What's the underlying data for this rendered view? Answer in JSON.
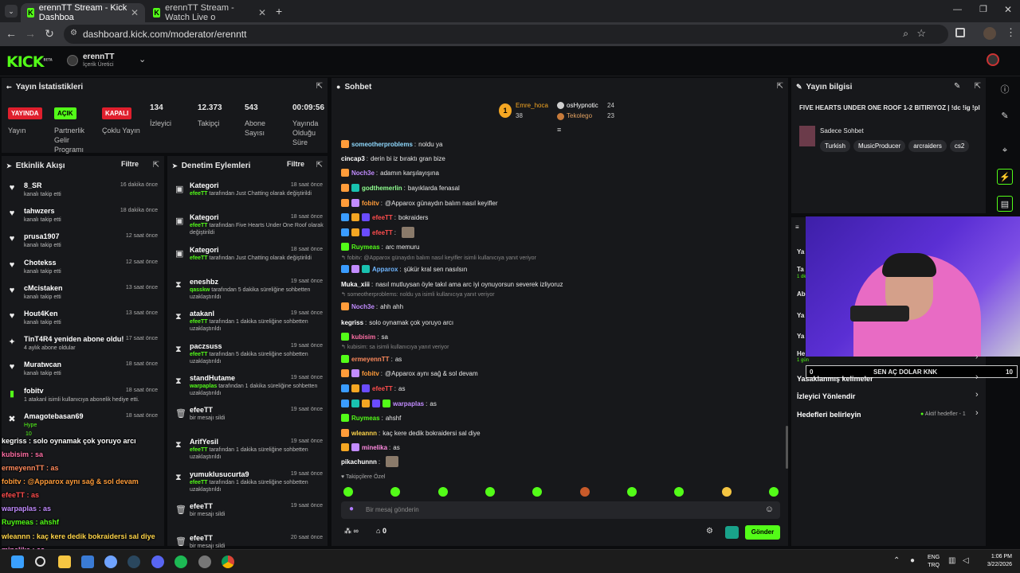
{
  "browser": {
    "tabs": [
      {
        "title": "erennTT Stream - Kick Dashboa"
      },
      {
        "title": "erennTT Stream - Watch Live o"
      }
    ],
    "url": "dashboard.kick.com/moderator/erenntt"
  },
  "header": {
    "logo": "KICK",
    "logo_tag": "BETA",
    "channel_name": "erennTT",
    "channel_role": "İçerik Üretici"
  },
  "stats": {
    "title": "Yayın İstatistikleri",
    "items": [
      {
        "badge": "YAYINDA",
        "label": "Yayın"
      },
      {
        "badge": "AÇIK",
        "label": "Partnerlik Gelir Programı"
      },
      {
        "badge": "KAPALI",
        "label": "Çoklu Yayın"
      }
    ],
    "numbers": [
      {
        "value": "134",
        "label": "İzleyici"
      },
      {
        "value": "12.373",
        "label": "Takipçi"
      },
      {
        "value": "543",
        "label": "Abone Sayısı"
      },
      {
        "value": "00:09:56",
        "label": "Yayında Olduğu Süre"
      }
    ]
  },
  "activity": {
    "title": "Etkinlik Akışı",
    "filter": "Filtre",
    "items": [
      {
        "name": "8_SR",
        "sub": "kanalı takip etti",
        "time": "16 dakika önce"
      },
      {
        "name": "tahwzers",
        "sub": "kanalı takip etti",
        "time": "18 dakika önce"
      },
      {
        "name": "prusa1907",
        "sub": "kanalı takip etti",
        "time": "12 saat önce"
      },
      {
        "name": "Chotekss",
        "sub": "kanalı takip etti",
        "time": "12 saat önce"
      },
      {
        "name": "cMcistaken",
        "sub": "kanalı takip etti",
        "time": "13 saat önce"
      },
      {
        "name": "Hout4Ken",
        "sub": "kanalı takip etti",
        "time": "13 saat önce"
      },
      {
        "name": "TinT4R4 yeniden abone oldu!",
        "sub": "4 aylık abone oldular",
        "time": "17 saat önce"
      },
      {
        "name": "Muratwcan",
        "sub": "kanalı takip etti",
        "time": "18 saat önce"
      },
      {
        "name": "fobitv",
        "sub": "1 atakanl isimli kullanıcıya abonelik hediye etti.",
        "time": "18 saat önce"
      },
      {
        "name": "Amagotebasan69",
        "sub": "Hype",
        "time": "18 saat önce"
      }
    ],
    "extra_count": "10"
  },
  "moderation": {
    "title": "Denetim Eylemleri",
    "filter": "Filtre",
    "items": [
      {
        "name": "Kategori",
        "sub_user": "efeeTT",
        "sub": "tarafından Just Chatting olarak değiştirildi",
        "time": "18 saat önce"
      },
      {
        "name": "Kategori",
        "sub_user": "efeeTT",
        "sub": "tarafından Five Hearts Under One Roof olarak değiştirildi",
        "time": "18 saat önce"
      },
      {
        "name": "Kategori",
        "sub_user": "efeeTT",
        "sub": "tarafından Just Chatting olarak değiştirildi",
        "time": "18 saat önce"
      },
      {
        "name": "eneshbz",
        "sub_user": "qasskw",
        "sub": "tarafından 5 dakika süreliğine sohbetten uzaklaştırıldı",
        "time": "19 saat önce"
      },
      {
        "name": "atakanl",
        "sub_user": "efeeTT",
        "sub": "tarafından 1 dakika süreliğine sohbetten uzaklaştırıldı",
        "time": "19 saat önce"
      },
      {
        "name": "paczsuss",
        "sub_user": "efeeTT",
        "sub": "tarafından 5 dakika süreliğine sohbetten uzaklaştırıldı",
        "time": "19 saat önce"
      },
      {
        "name": "standHutame",
        "sub_user": "warpaplas",
        "sub": "tarafından 1 dakika süreliğine sohbetten uzaklaştırıldı",
        "time": "19 saat önce"
      },
      {
        "name": "efeeTT",
        "sub_user": "",
        "sub": "bir mesajı sildi",
        "time": "19 saat önce"
      },
      {
        "name": "ArifYesil",
        "sub_user": "efeeTT",
        "sub": "tarafından 1 dakika süreliğine sohbetten uzaklaştırıldı",
        "time": "19 saat önce"
      },
      {
        "name": "yumukIusucurta9",
        "sub_user": "efeeTT",
        "sub": "tarafından 1 dakika süreliğine sohbetten uzaklaştırıldı",
        "time": "19 saat önce"
      },
      {
        "name": "efeeTT",
        "sub_user": "",
        "sub": "bir mesajı sildi",
        "time": "19 saat önce"
      },
      {
        "name": "efeeTT",
        "sub_user": "",
        "sub": "bir mesajı sildi",
        "time": "20 saat önce"
      }
    ]
  },
  "chat": {
    "title": "Sohbet",
    "top_gifters": [
      {
        "name": "Emre_hoca",
        "count": "38"
      },
      {
        "name": "osHypnotic",
        "count": "24"
      },
      {
        "name": "Tekolego",
        "count": "23"
      }
    ],
    "messages": [
      {
        "user": "someotherproblems",
        "color": "#8fd9ff",
        "text": "noldu ya"
      },
      {
        "user": "cincap3",
        "color": "#ffffff",
        "text": "derin bi iz bıraktı gran bize"
      },
      {
        "user": "Noch3e",
        "color": "#c28cff",
        "text": "adamın karşılayışına"
      },
      {
        "user": "godthemerlin",
        "color": "#8fff8f",
        "text": "bayıklarda fenasal"
      },
      {
        "user": "fobitv",
        "color": "#ff9c3a",
        "text": "@Apparox günaydın balım nasıl keyifler"
      },
      {
        "user": "efeeTT",
        "color": "#ff4d4d",
        "text": "bokraiders"
      },
      {
        "user": "efeeTT",
        "color": "#ff4d4d",
        "text": ""
      },
      {
        "user": "Ruymeas",
        "color": "#53fc18",
        "text": "arc memuru"
      },
      {
        "user": "Apparox",
        "color": "#6fb6ff",
        "text": "şükür kral sen nasılsın"
      },
      {
        "user": "Muka_xiii",
        "color": "#ffffff",
        "text": "nasıl mutluysan öyle takıl ama arc iyi oynuyorsun severek izliyoruz"
      },
      {
        "user": "Noch3e",
        "color": "#c28cff",
        "text": "ahh ahh"
      },
      {
        "user": "kegriss",
        "color": "#ffffff",
        "text": "solo oynamak çok yoruyo arcı"
      },
      {
        "user": "kubisim",
        "color": "#ff6fa5",
        "text": "sa"
      },
      {
        "user": "ermeyennTT",
        "color": "#ff8a5c",
        "text": "as"
      },
      {
        "user": "fobitv",
        "color": "#ff9c3a",
        "text": "@Apparox aynı sağ & sol devam"
      },
      {
        "user": "efeeTT",
        "color": "#ff4d4d",
        "text": "as"
      },
      {
        "user": "warpaplas",
        "color": "#c28cff",
        "text": "as"
      },
      {
        "user": "Ruymeas",
        "color": "#53fc18",
        "text": "ahshf"
      },
      {
        "user": "wleannn",
        "color": "#ffd54a",
        "text": "kaç kere dedik bokraidersi sal diye"
      },
      {
        "user": "minelika",
        "color": "#ff8adf",
        "text": "as"
      },
      {
        "user": "pikachunnn",
        "color": "#ffffff",
        "text": ""
      }
    ],
    "replies": [
      {
        "text": "fobitv: @Apparox günaydın balım nasıl keyifler   isimli kullanıcıya yanıt veriyor"
      },
      {
        "text": "someotherproblems: noldu ya isimli kullanıcıya yanıt veriyor"
      },
      {
        "text": "kubisim: sa isimli kullanıcıya yanıt veriyor"
      }
    ],
    "followers_only": "Takipçilere Özel",
    "input_placeholder": "Bir mesaj gönderin",
    "send_button": "Gönder",
    "infinity": "∞",
    "count": "0"
  },
  "stream_info": {
    "title": "Yayın bilgisi",
    "stream_title": "FIVE HEARTS UNDER ONE ROOF 1-2 BITIRIYOZ | !dc !ig !pl",
    "category": "Sadece Sohbet",
    "tags": [
      "Turkish",
      "MusicProducer",
      "arcraiders",
      "cs2"
    ]
  },
  "settings_panel": {
    "rows": [
      {
        "label": "Yasaklanmış kelimeler"
      },
      {
        "label": "İzleyici Yönlendir"
      },
      {
        "label": "Hedefleri belirleyin",
        "extra": "Aktif hedefler - 1"
      }
    ],
    "goal": {
      "left": "0",
      "text": "SEN AÇ DOLAR KNK",
      "right": "10"
    },
    "partial_labels": [
      "Ya",
      "Ta",
      "1 dk",
      "Ab",
      "Ya",
      "Ya",
      "He",
      "1 gün"
    ]
  },
  "overlay": {
    "lines": [
      {
        "text": "kegriss : solo oynamak çok yoruyo arcı"
      },
      {
        "text": "kubisim : sa"
      },
      {
        "text": "ermeyennTT : as"
      },
      {
        "text": "fobitv : @Apparox aynı sağ & sol devam"
      },
      {
        "text": "efeeTT : as"
      },
      {
        "text": "warpaplas : as"
      },
      {
        "text": "Ruymeas : ahshf"
      },
      {
        "text": "wleannn : kaç kere dedik bokraidersi sal diye"
      },
      {
        "text": "minelika : as"
      },
      {
        "text": "pikachunnn :"
      }
    ]
  },
  "taskbar": {
    "lang": "ENG",
    "lang2": "TRQ",
    "time": "1:06 PM",
    "date": "3/22/2026"
  },
  "colors": {
    "accent": "#53fc18",
    "panel": "#17181b",
    "background": "#0b0c0e"
  }
}
